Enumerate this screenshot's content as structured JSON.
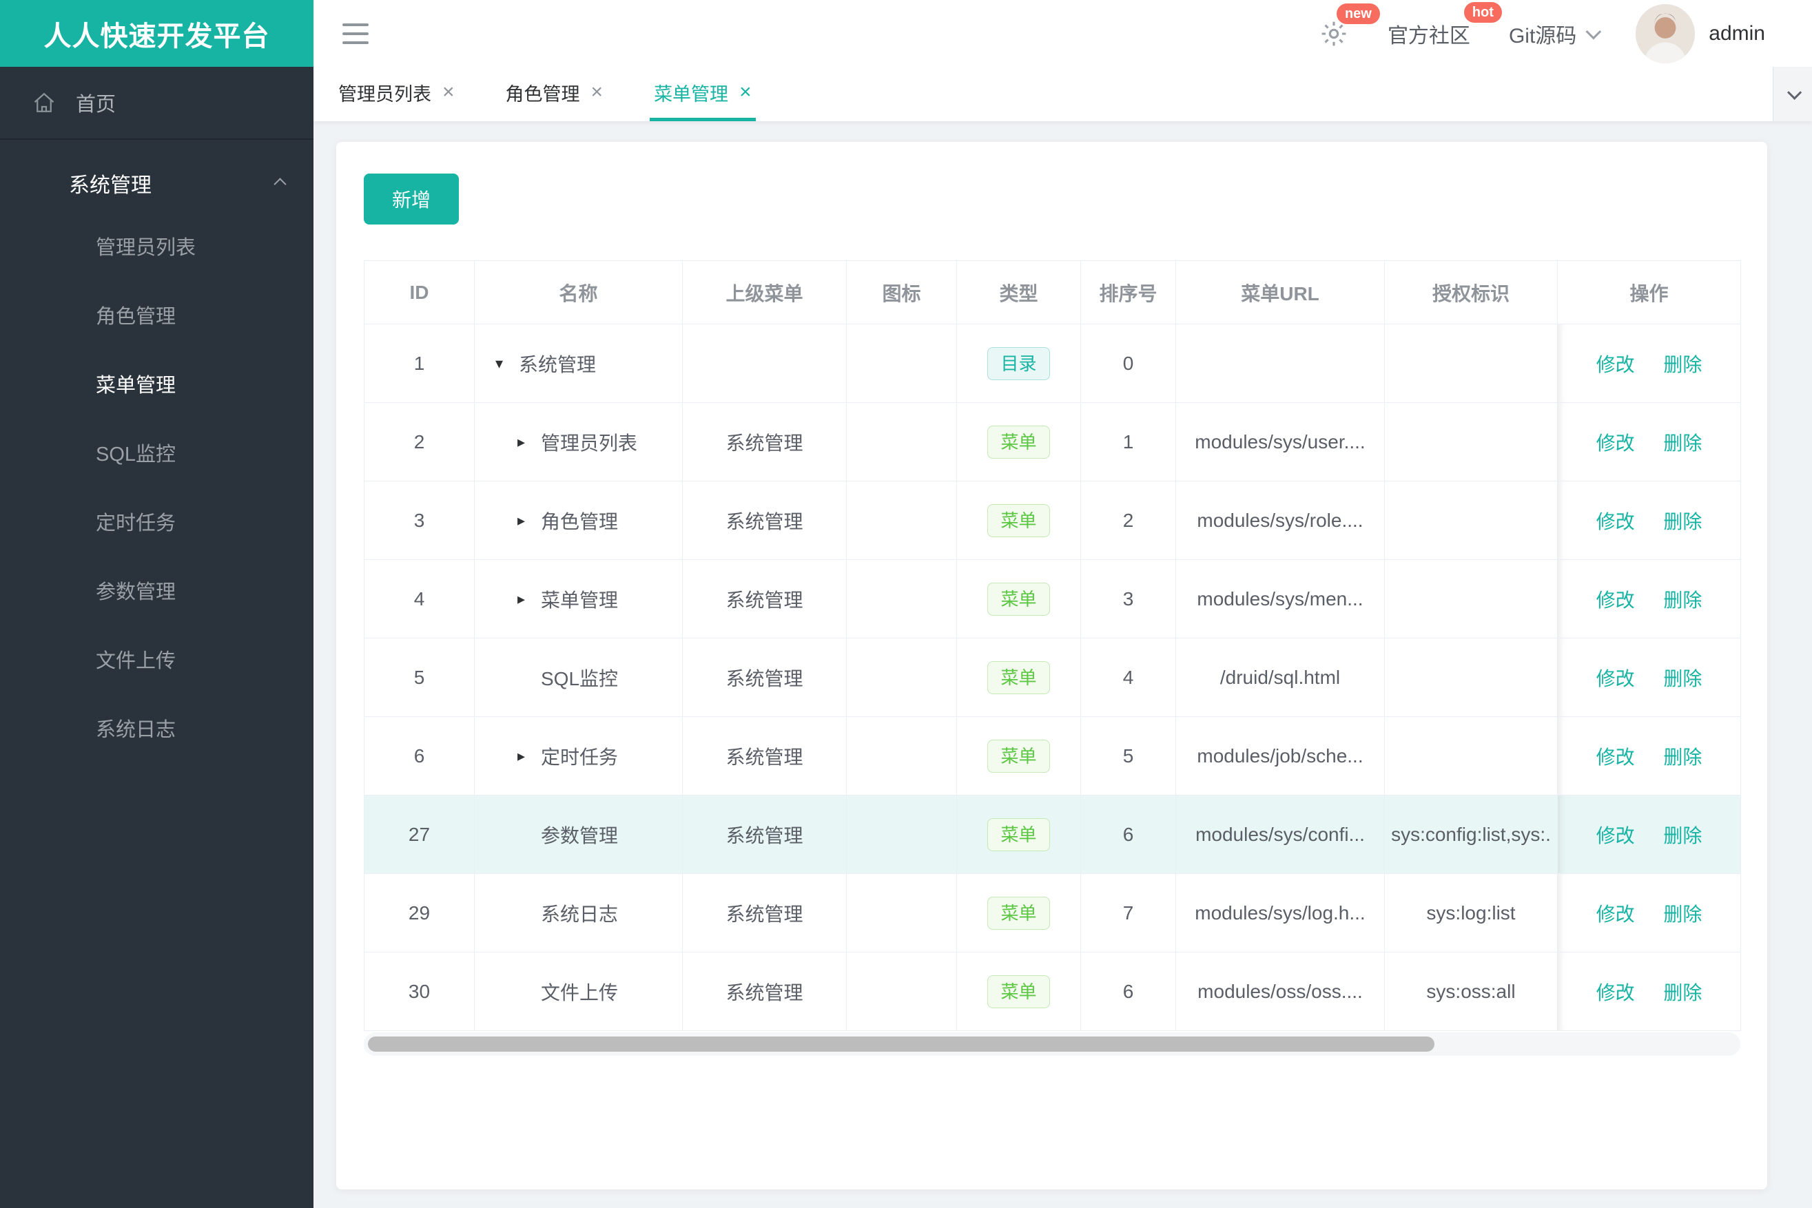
{
  "app": {
    "title": "人人快速开发平台"
  },
  "header": {
    "badge_new": "new",
    "community_label": "官方社区",
    "badge_hot": "hot",
    "git_label": "Git源码",
    "user_name": "admin"
  },
  "sidebar": {
    "home_label": "首页",
    "group_label": "系统管理",
    "items": [
      {
        "label": "管理员列表",
        "active": false
      },
      {
        "label": "角色管理",
        "active": false
      },
      {
        "label": "菜单管理",
        "active": true
      },
      {
        "label": "SQL监控",
        "active": false
      },
      {
        "label": "定时任务",
        "active": false
      },
      {
        "label": "参数管理",
        "active": false
      },
      {
        "label": "文件上传",
        "active": false
      },
      {
        "label": "系统日志",
        "active": false
      }
    ]
  },
  "tabs": [
    {
      "label": "管理员列表",
      "close": "×",
      "active": false
    },
    {
      "label": "角色管理",
      "close": "×",
      "active": false
    },
    {
      "label": "菜单管理",
      "close": "×",
      "active": true
    }
  ],
  "toolbar": {
    "add_label": "新增"
  },
  "table": {
    "columns": [
      "ID",
      "名称",
      "上级菜单",
      "图标",
      "类型",
      "排序号",
      "菜单URL",
      "授权标识",
      "操作"
    ],
    "actions": {
      "edit": "修改",
      "delete": "删除"
    },
    "rows": [
      {
        "id": "1",
        "name": "系统管理",
        "arrow": "down",
        "level": 0,
        "parent": "",
        "type_kind": "dir",
        "type_label": "目录",
        "order": "0",
        "url": "",
        "perms": "",
        "highlight": false
      },
      {
        "id": "2",
        "name": "管理员列表",
        "arrow": "right",
        "level": 1,
        "parent": "系统管理",
        "type_kind": "menu",
        "type_label": "菜单",
        "order": "1",
        "url": "modules/sys/user....",
        "perms": "",
        "highlight": false
      },
      {
        "id": "3",
        "name": "角色管理",
        "arrow": "right",
        "level": 1,
        "parent": "系统管理",
        "type_kind": "menu",
        "type_label": "菜单",
        "order": "2",
        "url": "modules/sys/role....",
        "perms": "",
        "highlight": false
      },
      {
        "id": "4",
        "name": "菜单管理",
        "arrow": "right",
        "level": 1,
        "parent": "系统管理",
        "type_kind": "menu",
        "type_label": "菜单",
        "order": "3",
        "url": "modules/sys/men...",
        "perms": "",
        "highlight": false
      },
      {
        "id": "5",
        "name": "SQL监控",
        "arrow": "none",
        "level": 1,
        "parent": "系统管理",
        "type_kind": "menu",
        "type_label": "菜单",
        "order": "4",
        "url": "/druid/sql.html",
        "perms": "",
        "highlight": false
      },
      {
        "id": "6",
        "name": "定时任务",
        "arrow": "right",
        "level": 1,
        "parent": "系统管理",
        "type_kind": "menu",
        "type_label": "菜单",
        "order": "5",
        "url": "modules/job/sche...",
        "perms": "",
        "highlight": false
      },
      {
        "id": "27",
        "name": "参数管理",
        "arrow": "none",
        "level": 1,
        "parent": "系统管理",
        "type_kind": "menu",
        "type_label": "菜单",
        "order": "6",
        "url": "modules/sys/confi...",
        "perms": "sys:config:list,sys:.",
        "highlight": true
      },
      {
        "id": "29",
        "name": "系统日志",
        "arrow": "none",
        "level": 1,
        "parent": "系统管理",
        "type_kind": "menu",
        "type_label": "菜单",
        "order": "7",
        "url": "modules/sys/log.h...",
        "perms": "sys:log:list",
        "highlight": false
      },
      {
        "id": "30",
        "name": "文件上传",
        "arrow": "none",
        "level": 1,
        "parent": "系统管理",
        "type_kind": "menu",
        "type_label": "菜单",
        "order": "6",
        "url": "modules/oss/oss....",
        "perms": "sys:oss:all",
        "highlight": false
      }
    ]
  },
  "colors": {
    "brand": "#17b3a3",
    "sidebar_bg": "#2a333b",
    "badge_red": "#f76c5f",
    "tag_dir_text": "#17b3a3",
    "tag_dir_bg": "#e9f7f6",
    "tag_dir_border": "#abdfd9",
    "tag_menu_text": "#5cc743",
    "tag_menu_bg": "#f3faee",
    "tag_menu_border": "#c5e9b6",
    "row_highlight": "#e8f6f5",
    "link_teal": "#17b3a3"
  }
}
